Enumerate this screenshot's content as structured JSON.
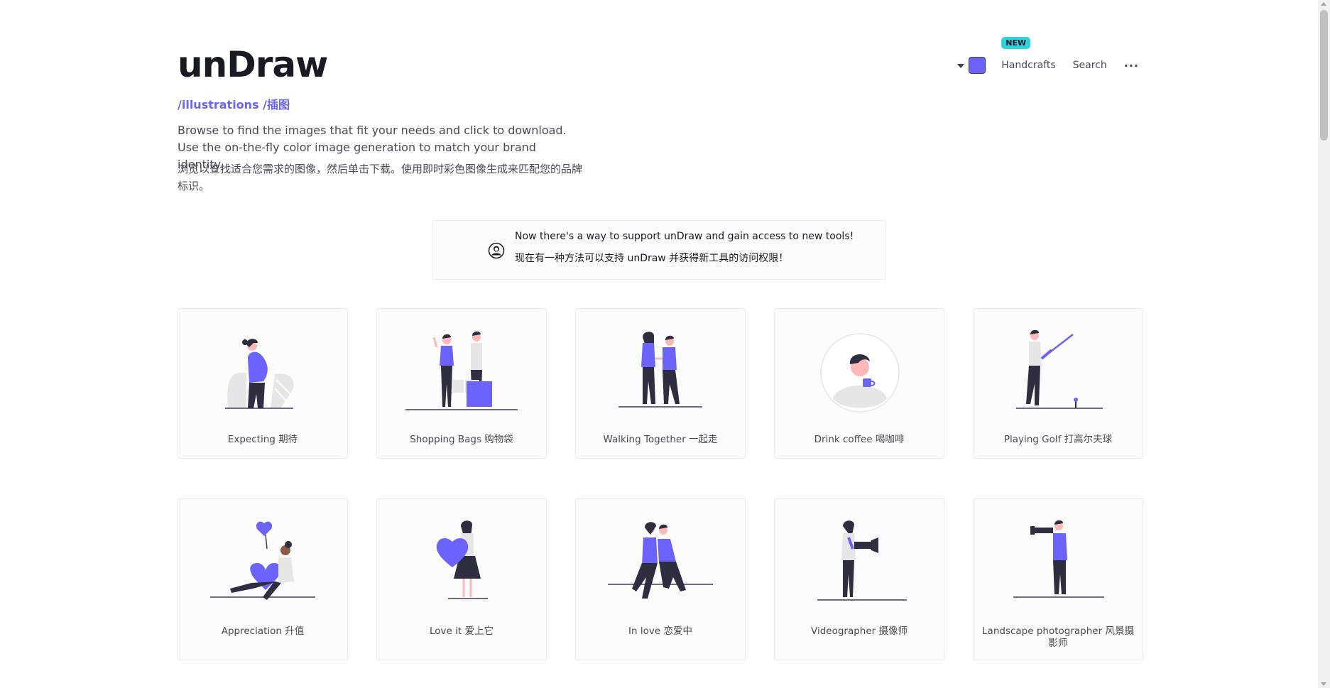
{
  "brand": "unDraw",
  "path": "/illustrations /插图",
  "description_en": "Browse to find the images that fit your needs and click to download. Use the on-the-fly color image generation to match your brand identity.",
  "description_zh": "浏览以查找适合您需求的图像，然后单击下载。使用即时彩色图像生成来匹配您的品牌标识。",
  "nav": {
    "color_accent": "#6c63ff",
    "badge": "NEW",
    "handcrafts": "Handcrafts",
    "search": "Search",
    "more": "···"
  },
  "notice": {
    "line_en": "Now there's a way to support unDraw and gain access to new tools!",
    "line_zh": "现在有一种方法可以支持 unDraw 并获得新工具的访问权限！",
    "icon": "user-circle-icon"
  },
  "colors": {
    "accent": "#6c63ff",
    "dark": "#2f2e41",
    "skin": "#ffb8b8",
    "badge": "#2ad4dd"
  },
  "illustrations": [
    {
      "label": "Expecting 期待"
    },
    {
      "label": "Shopping Bags 购物袋"
    },
    {
      "label": "Walking Together 一起走"
    },
    {
      "label": "Drink coffee 喝咖啡"
    },
    {
      "label": "Playing Golf 打高尔夫球"
    },
    {
      "label": "Appreciation 升值"
    },
    {
      "label": "Love it 爱上它"
    },
    {
      "label": "In love 恋爱中"
    },
    {
      "label": "Videographer 摄像师"
    },
    {
      "label": "Landscape photographer 风景摄影师"
    }
  ]
}
